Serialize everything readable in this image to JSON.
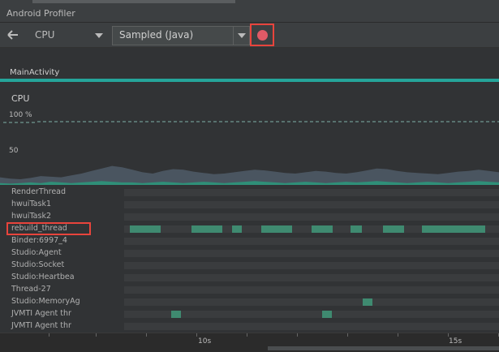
{
  "window": {
    "title": "Android Profiler"
  },
  "toolbar": {
    "back_icon": "arrow-left-icon",
    "monitor": "CPU",
    "configuration": "Sampled (Java)",
    "record_icon": "record-icon",
    "record_color": "#e05a66"
  },
  "activity": {
    "label": "MainActivity",
    "color": "#25a59a"
  },
  "cpu": {
    "title": "CPU",
    "y_top_label": "100 %",
    "y_mid_label": "50"
  },
  "chart_data": {
    "type": "area",
    "title": "CPU",
    "ylabel": "",
    "ylim": [
      0,
      100
    ],
    "y_ticks": [
      "100 %",
      "50"
    ],
    "threshold": 100,
    "x_ticks": [
      "10s",
      "15s"
    ],
    "series": [
      {
        "values": [
          12,
          10,
          9,
          11,
          14,
          13,
          12,
          15,
          18,
          22,
          26,
          30,
          28,
          24,
          20,
          18,
          22,
          25,
          24,
          21,
          19,
          17,
          18,
          20,
          22,
          24,
          23,
          21,
          19,
          18,
          20,
          22,
          21,
          19,
          18,
          20,
          23,
          26,
          25,
          22,
          20,
          19,
          18,
          17,
          19,
          21,
          22,
          24,
          22,
          20
        ]
      },
      {
        "values": [
          3,
          2,
          3,
          4,
          3,
          5,
          4,
          3,
          4,
          5,
          6,
          5,
          4,
          4,
          3,
          4,
          5,
          4,
          3,
          4,
          5,
          4,
          3,
          4,
          5,
          6,
          5,
          4,
          3,
          4,
          5,
          4,
          3,
          4,
          5,
          4,
          5,
          6,
          5,
          4,
          3,
          4,
          5,
          4,
          3,
          4,
          5,
          6,
          5,
          4
        ]
      }
    ]
  },
  "threads": [
    {
      "name": "RenderThread",
      "segments": []
    },
    {
      "name": "hwuiTask1",
      "segments": []
    },
    {
      "name": "hwuiTask2",
      "segments": []
    },
    {
      "name": "rebuild_thread",
      "highlighted": true,
      "segments": [
        [
          160,
          198
        ],
        [
          236,
          274
        ],
        [
          286,
          298
        ],
        [
          322,
          360
        ],
        [
          384,
          410
        ],
        [
          432,
          446
        ],
        [
          472,
          498
        ],
        [
          520,
          598
        ]
      ]
    },
    {
      "name": "Binder:6997_4",
      "segments": []
    },
    {
      "name": "Studio:Agent",
      "segments": []
    },
    {
      "name": "Studio:Socket",
      "segments": []
    },
    {
      "name": "Studio:Heartbea",
      "segments": []
    },
    {
      "name": "Thread-27",
      "segments": []
    },
    {
      "name": "Studio:MemoryAg",
      "segments": [
        [
          447,
          459
        ]
      ]
    },
    {
      "name": "JVMTI Agent thr",
      "segments": [
        [
          211,
          223
        ],
        [
          397,
          409
        ]
      ]
    },
    {
      "name": "JVMTI Agent thr",
      "segments": []
    }
  ],
  "axis": {
    "labels": [
      "10s",
      "15s"
    ]
  }
}
